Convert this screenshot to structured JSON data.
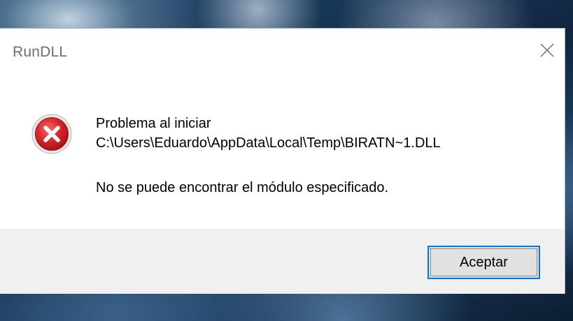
{
  "dialog": {
    "title": "RunDLL",
    "icon": "error-icon",
    "close_icon": "close-icon",
    "message_line1": "Problema al iniciar",
    "message_line2": "C:\\Users\\Eduardo\\AppData\\Local\\Temp\\BIRATN~1.DLL",
    "message_line3": "No se puede encontrar el módulo especificado.",
    "ok_label": "Aceptar"
  },
  "colors": {
    "error_red": "#c42b1c",
    "accent_blue": "#0078d7",
    "footer_bg": "#f0f0f0"
  }
}
